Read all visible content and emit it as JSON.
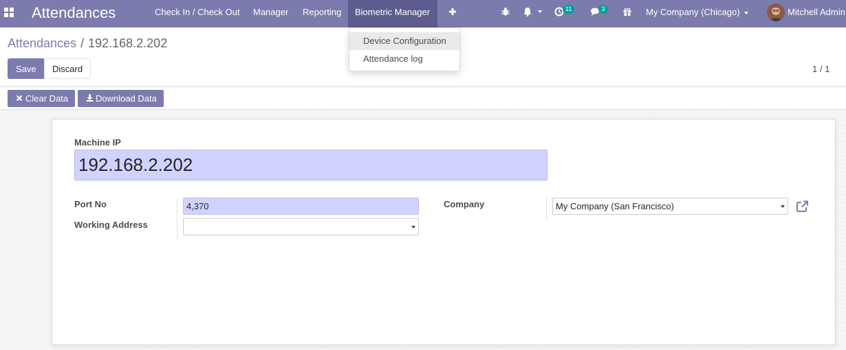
{
  "navbar": {
    "app_title": "Attendances",
    "menus": [
      "Check In / Check Out",
      "Manager",
      "Reporting",
      "Biometric Manager"
    ],
    "activity_count": "11",
    "message_count": "3",
    "company_switcher": "My Company (Chicago)",
    "user_name": "Mitchell Admin",
    "icons": [
      "apps-grid-icon",
      "plus-icon",
      "bug-icon",
      "bell-icon",
      "clock-icon",
      "chat-icon",
      "gift-icon"
    ]
  },
  "dropdown": {
    "items": [
      "Device Configuration",
      "Attendance log"
    ]
  },
  "breadcrumb": {
    "parent": "Attendances",
    "separator": "/",
    "current": "192.168.2.202"
  },
  "actions": {
    "save": "Save",
    "discard": "Discard",
    "pager": "1 / 1"
  },
  "statusbar": {
    "clear": "Clear Data",
    "download": "Download Data"
  },
  "form": {
    "machine_ip_label": "Machine IP",
    "machine_ip": "192.168.2.202",
    "port_label": "Port No",
    "port": "4,370",
    "working_address_label": "Working Address",
    "working_address": "",
    "company_label": "Company",
    "company": "My Company (San Francisco)"
  },
  "colors": {
    "primary": "#7c7bad",
    "required_field": "#d2d2ff",
    "badge": "#00a09d"
  }
}
